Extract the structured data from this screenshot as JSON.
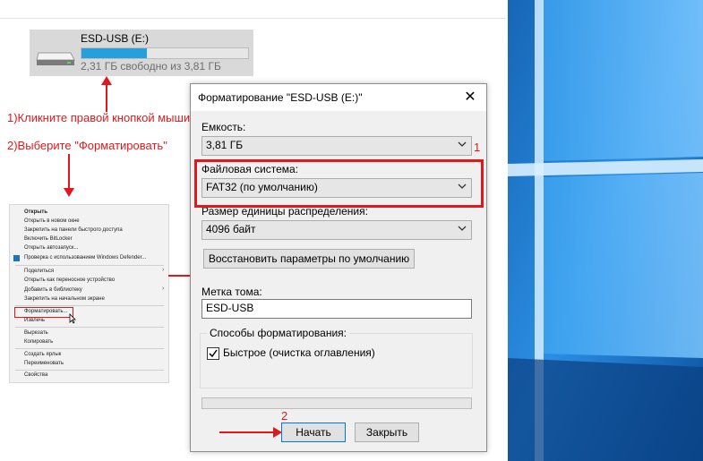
{
  "drive": {
    "name": "ESD-USB (E:)",
    "free_text": "2,31 ГБ свободно из 3,81 ГБ",
    "used_fraction": 0.39
  },
  "steps": {
    "step1": "1)Кликните правой кнопкой мыши",
    "step2": "2)Выберите \"Форматировать\""
  },
  "context_menu": {
    "items": [
      "Открыть",
      "Открыть в новом окне",
      "Закрепить на панели быстрого доступа",
      "Включить BitLocker",
      "Открыть автозапуск...",
      "Проверка с использованием Windows Defender...",
      "Поделиться",
      "Открыть как переносное устройство",
      "Добавить в библиотеку",
      "Закрепить на начальном экране",
      "Форматировать...",
      "Извлечь",
      "Вырезать",
      "Копировать",
      "Создать ярлык",
      "Переименовать",
      "Свойства"
    ]
  },
  "dialog": {
    "title": "Форматирование \"ESD-USB (E:)\"",
    "close_glyph": "✕",
    "capacity_label": "Емкость:",
    "capacity_value": "3,81 ГБ",
    "fs_label": "Файловая система:",
    "fs_value": "FAT32 (по умолчанию)",
    "alloc_label": "Размер единицы распределения:",
    "alloc_value": "4096 байт",
    "restore_button": "Восстановить параметры по умолчанию",
    "volume_label": "Метка тома:",
    "volume_value": "ESD-USB",
    "format_options_label": "Способы форматирования:",
    "quick_format_label": "Быстрое (очистка оглавления)",
    "quick_format_checked": true,
    "start_button": "Начать",
    "close_button": "Закрыть"
  },
  "annotations": {
    "num1": "1",
    "num2": "2"
  },
  "colors": {
    "accent_red": "#e0181b",
    "progress_blue": "#26a0da",
    "desktop_blue": "#1a6fc4"
  }
}
